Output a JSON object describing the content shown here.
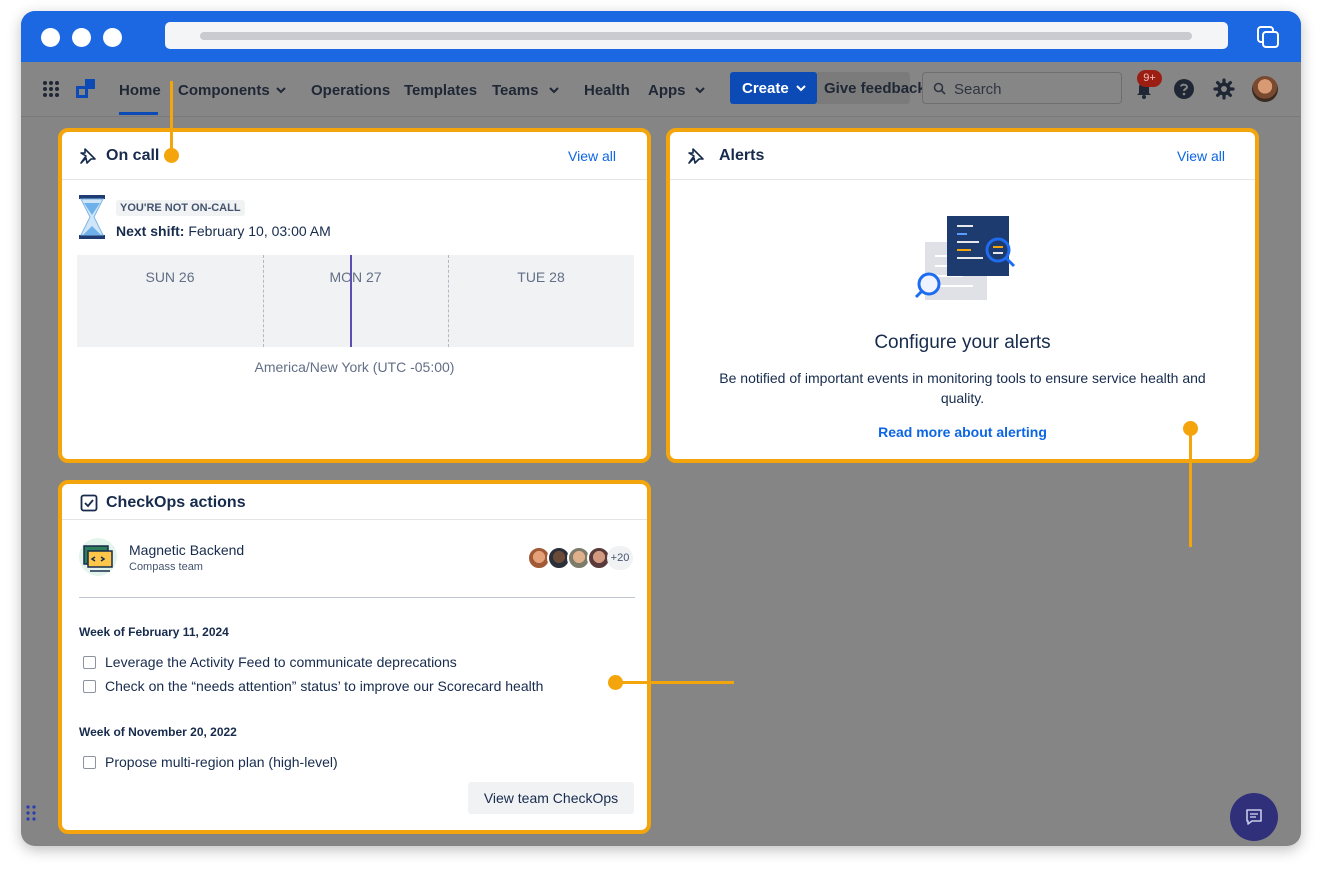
{
  "nav": {
    "items": [
      {
        "label": "Home"
      },
      {
        "label": "Components"
      },
      {
        "label": "Operations"
      },
      {
        "label": "Templates"
      },
      {
        "label": "Teams"
      },
      {
        "label": "Health"
      },
      {
        "label": "Apps"
      }
    ],
    "create_label": "Create",
    "feedback_label": "Give feedback",
    "search_placeholder": "Search",
    "notification_count": "9+"
  },
  "oncall": {
    "title": "On call",
    "view_all": "View all",
    "status_tag": "YOU'RE NOT ON-CALL",
    "next_shift_label": "Next shift:",
    "next_shift_value": "February 10, 03:00 AM",
    "days": [
      "SUN 26",
      "MON 27",
      "TUE 28"
    ],
    "timezone": "America/New York (UTC -05:00)"
  },
  "alerts": {
    "title": "Alerts",
    "view_all": "View all",
    "heading": "Configure your alerts",
    "description": "Be notified of important events in monitoring tools to ensure service health and quality.",
    "link": "Read more about alerting"
  },
  "checkops": {
    "title": "CheckOps actions",
    "team_name": "Magnetic Backend",
    "team_type": "Compass team",
    "member_extra": "+20",
    "weeks": [
      {
        "label": "Week of February 11, 2024",
        "tasks": [
          "Leverage the Activity Feed to communicate deprecations",
          "Check on the “needs attention” status’ to improve our Scorecard health"
        ]
      },
      {
        "label": "Week of November 20, 2022",
        "tasks": [
          "Propose multi-region plan (high-level)"
        ]
      }
    ],
    "button": "View team CheckOps"
  },
  "colors": {
    "browser_blue": "#1b68e2",
    "highlight_orange": "#f5a50c",
    "link_blue": "#0c66e4",
    "create_blue": "#0c4bb6",
    "chat_purple": "#302f7a"
  }
}
